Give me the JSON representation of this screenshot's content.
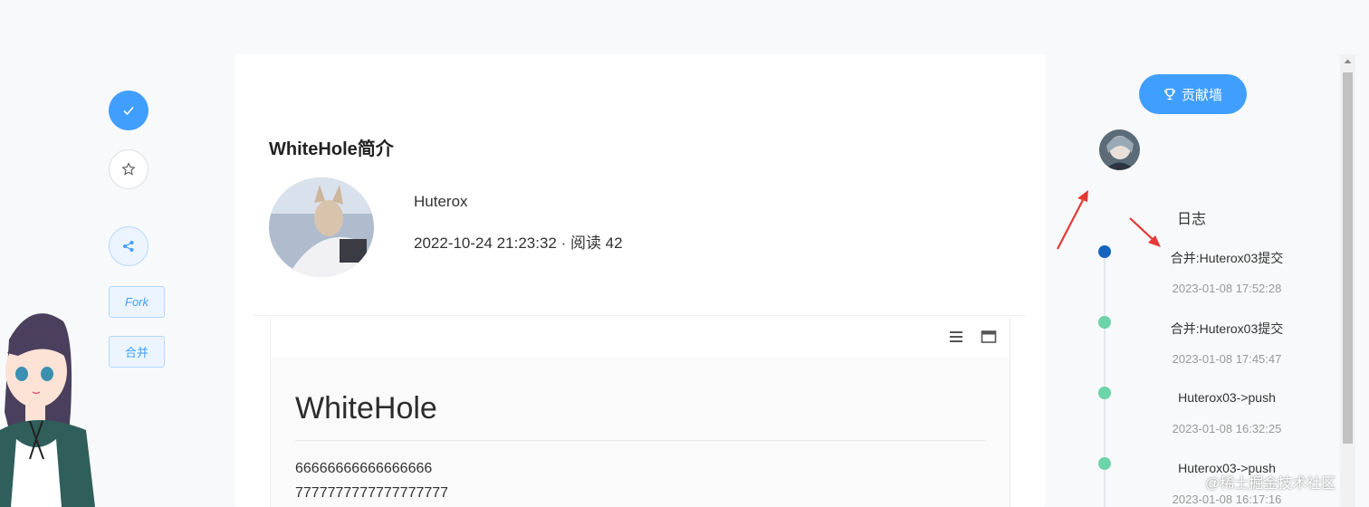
{
  "left_rail": {
    "fork_label": "Fork",
    "merge_label": "合并"
  },
  "post": {
    "title": "WhiteHole简介",
    "author": "Huterox",
    "meta": "2022-10-24 21:23:32 · 阅读 42",
    "doc": {
      "heading": "WhiteHole",
      "lines": [
        "66666666666666666",
        "7777777777777777777"
      ]
    }
  },
  "right_panel": {
    "contrib_label": "贡献墙",
    "log_title": "日志",
    "timeline": [
      {
        "title": "合并:Huterox03提交",
        "time": "2023-01-08 17:52:28",
        "dot_color": "#1565c0"
      },
      {
        "title": "合并:Huterox03提交",
        "time": "2023-01-08 17:45:47",
        "dot_color": "#6dd3a8"
      },
      {
        "title": "Huterox03->push",
        "time": "2023-01-08 16:32:25",
        "dot_color": "#6dd3a8"
      },
      {
        "title": "Huterox03->push",
        "time": "2023-01-08 16:17:16",
        "dot_color": "#6dd3a8"
      }
    ]
  },
  "watermark": "@稀土掘金技术社区",
  "colors": {
    "accent": "#409eff",
    "arrow": "#e53935"
  }
}
